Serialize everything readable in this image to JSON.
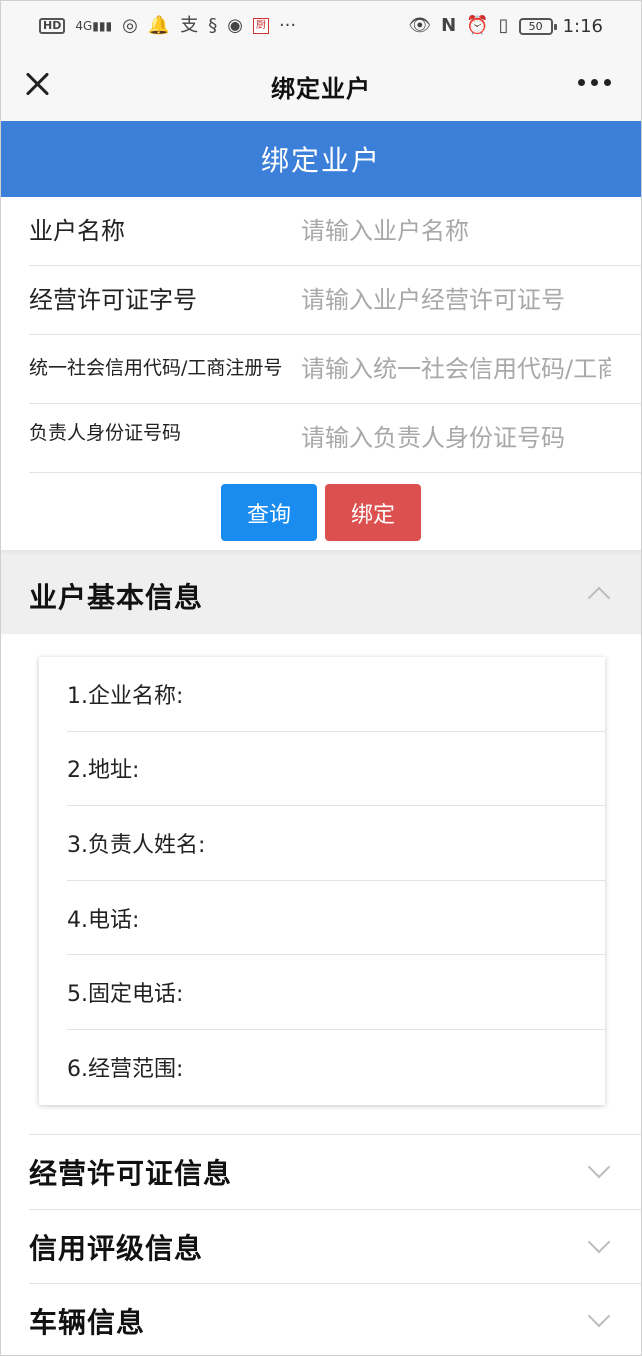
{
  "status_bar": {
    "network": "4G",
    "time": "1:16",
    "battery": "50"
  },
  "nav": {
    "title": "绑定业户"
  },
  "header": {
    "title": "绑定业户"
  },
  "form": {
    "fields": [
      {
        "label": "业户名称",
        "placeholder": "请输入业户名称"
      },
      {
        "label": "经营许可证字号",
        "placeholder": "请输入业户经营许可证号"
      },
      {
        "label": "统一社会信用代码/工商注册号",
        "placeholder": "请输入统一社会信用代码/工商注册号"
      },
      {
        "label": "负责人身份证号码",
        "placeholder": "请输入负责人身份证号码"
      }
    ],
    "query_label": "查询",
    "bind_label": "绑定"
  },
  "basic_info": {
    "title": "业户基本信息",
    "items": [
      "1.企业名称:",
      "2.地址:",
      "3.负责人姓名:",
      "4.电话:",
      "5.固定电话:",
      "6.经营范围:"
    ]
  },
  "sections": [
    {
      "title": "经营许可证信息"
    },
    {
      "title": "信用评级信息"
    },
    {
      "title": "车辆信息"
    }
  ],
  "icons": {
    "close": "close-icon",
    "more": "more-icon",
    "expand": "chevron-up-icon",
    "collapse": "chevron-down-icon"
  }
}
